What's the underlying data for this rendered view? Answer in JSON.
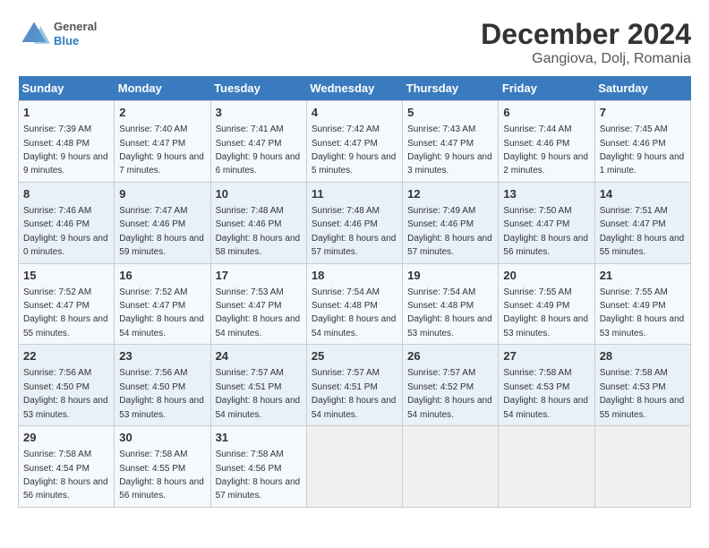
{
  "logo": {
    "line1": "General",
    "line2": "Blue"
  },
  "title": "December 2024",
  "subtitle": "Gangiova, Dolj, Romania",
  "days_of_week": [
    "Sunday",
    "Monday",
    "Tuesday",
    "Wednesday",
    "Thursday",
    "Friday",
    "Saturday"
  ],
  "weeks": [
    [
      {
        "day": "1",
        "sunrise": "7:39 AM",
        "sunset": "4:48 PM",
        "daylight": "9 hours and 9 minutes."
      },
      {
        "day": "2",
        "sunrise": "7:40 AM",
        "sunset": "4:47 PM",
        "daylight": "9 hours and 7 minutes."
      },
      {
        "day": "3",
        "sunrise": "7:41 AM",
        "sunset": "4:47 PM",
        "daylight": "9 hours and 6 minutes."
      },
      {
        "day": "4",
        "sunrise": "7:42 AM",
        "sunset": "4:47 PM",
        "daylight": "9 hours and 5 minutes."
      },
      {
        "day": "5",
        "sunrise": "7:43 AM",
        "sunset": "4:47 PM",
        "daylight": "9 hours and 3 minutes."
      },
      {
        "day": "6",
        "sunrise": "7:44 AM",
        "sunset": "4:46 PM",
        "daylight": "9 hours and 2 minutes."
      },
      {
        "day": "7",
        "sunrise": "7:45 AM",
        "sunset": "4:46 PM",
        "daylight": "9 hours and 1 minute."
      }
    ],
    [
      {
        "day": "8",
        "sunrise": "7:46 AM",
        "sunset": "4:46 PM",
        "daylight": "9 hours and 0 minutes."
      },
      {
        "day": "9",
        "sunrise": "7:47 AM",
        "sunset": "4:46 PM",
        "daylight": "8 hours and 59 minutes."
      },
      {
        "day": "10",
        "sunrise": "7:48 AM",
        "sunset": "4:46 PM",
        "daylight": "8 hours and 58 minutes."
      },
      {
        "day": "11",
        "sunrise": "7:48 AM",
        "sunset": "4:46 PM",
        "daylight": "8 hours and 57 minutes."
      },
      {
        "day": "12",
        "sunrise": "7:49 AM",
        "sunset": "4:46 PM",
        "daylight": "8 hours and 57 minutes."
      },
      {
        "day": "13",
        "sunrise": "7:50 AM",
        "sunset": "4:47 PM",
        "daylight": "8 hours and 56 minutes."
      },
      {
        "day": "14",
        "sunrise": "7:51 AM",
        "sunset": "4:47 PM",
        "daylight": "8 hours and 55 minutes."
      }
    ],
    [
      {
        "day": "15",
        "sunrise": "7:52 AM",
        "sunset": "4:47 PM",
        "daylight": "8 hours and 55 minutes."
      },
      {
        "day": "16",
        "sunrise": "7:52 AM",
        "sunset": "4:47 PM",
        "daylight": "8 hours and 54 minutes."
      },
      {
        "day": "17",
        "sunrise": "7:53 AM",
        "sunset": "4:47 PM",
        "daylight": "8 hours and 54 minutes."
      },
      {
        "day": "18",
        "sunrise": "7:54 AM",
        "sunset": "4:48 PM",
        "daylight": "8 hours and 54 minutes."
      },
      {
        "day": "19",
        "sunrise": "7:54 AM",
        "sunset": "4:48 PM",
        "daylight": "8 hours and 53 minutes."
      },
      {
        "day": "20",
        "sunrise": "7:55 AM",
        "sunset": "4:49 PM",
        "daylight": "8 hours and 53 minutes."
      },
      {
        "day": "21",
        "sunrise": "7:55 AM",
        "sunset": "4:49 PM",
        "daylight": "8 hours and 53 minutes."
      }
    ],
    [
      {
        "day": "22",
        "sunrise": "7:56 AM",
        "sunset": "4:50 PM",
        "daylight": "8 hours and 53 minutes."
      },
      {
        "day": "23",
        "sunrise": "7:56 AM",
        "sunset": "4:50 PM",
        "daylight": "8 hours and 53 minutes."
      },
      {
        "day": "24",
        "sunrise": "7:57 AM",
        "sunset": "4:51 PM",
        "daylight": "8 hours and 54 minutes."
      },
      {
        "day": "25",
        "sunrise": "7:57 AM",
        "sunset": "4:51 PM",
        "daylight": "8 hours and 54 minutes."
      },
      {
        "day": "26",
        "sunrise": "7:57 AM",
        "sunset": "4:52 PM",
        "daylight": "8 hours and 54 minutes."
      },
      {
        "day": "27",
        "sunrise": "7:58 AM",
        "sunset": "4:53 PM",
        "daylight": "8 hours and 54 minutes."
      },
      {
        "day": "28",
        "sunrise": "7:58 AM",
        "sunset": "4:53 PM",
        "daylight": "8 hours and 55 minutes."
      }
    ],
    [
      {
        "day": "29",
        "sunrise": "7:58 AM",
        "sunset": "4:54 PM",
        "daylight": "8 hours and 56 minutes."
      },
      {
        "day": "30",
        "sunrise": "7:58 AM",
        "sunset": "4:55 PM",
        "daylight": "8 hours and 56 minutes."
      },
      {
        "day": "31",
        "sunrise": "7:58 AM",
        "sunset": "4:56 PM",
        "daylight": "8 hours and 57 minutes."
      },
      null,
      null,
      null,
      null
    ]
  ]
}
